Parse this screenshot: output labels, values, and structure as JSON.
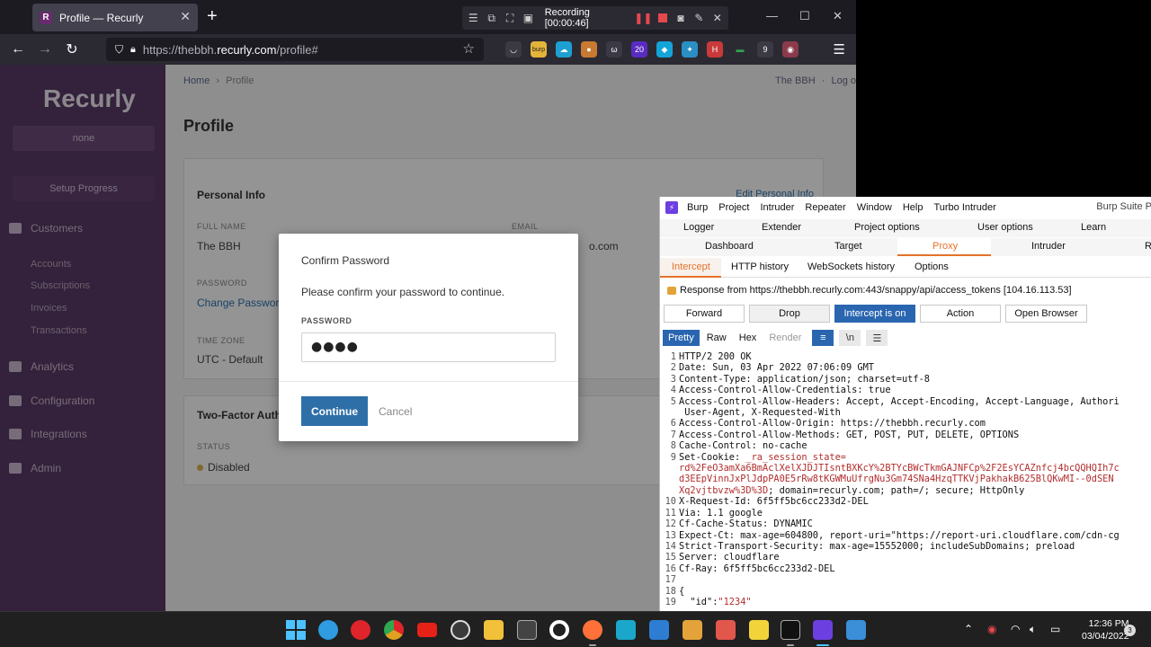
{
  "browser": {
    "tab_title": "Profile — Recurly",
    "tab_favicon": "R",
    "recording": "Recording [00:00:46]",
    "url_prefix": "https://thebbh.",
    "url_domain": "recurly.com",
    "url_suffix": "/profile#",
    "ext_burp": "burp",
    "ext_badge_20": "20",
    "ext_badge_9": "9"
  },
  "page": {
    "logo": "Recurly",
    "account_pill": "none",
    "setup_progress": "Setup Progress",
    "nav": {
      "customers": "Customers",
      "accounts": "Accounts",
      "subscriptions": "Subscriptions",
      "invoices": "Invoices",
      "transactions": "Transactions",
      "analytics": "Analytics",
      "configuration": "Configuration",
      "integrations": "Integrations",
      "admin": "Admin"
    },
    "breadcrumb_home": "Home",
    "breadcrumb_sep": "›",
    "breadcrumb_current": "Profile",
    "top_user": "The BBH",
    "top_sep": "·",
    "top_logout": "Log o",
    "title": "Profile",
    "personal_info": "Personal Info",
    "edit_personal_info": "Edit Personal Info",
    "full_name_label": "FULL NAME",
    "full_name": "The BBH",
    "email_label": "EMAIL",
    "email_tail": "o.com",
    "password_label": "PASSWORD",
    "change_password": "Change Password",
    "time_zone_label": "TIME ZONE",
    "time_zone": "UTC - Default",
    "two_factor": "Two-Factor Authe",
    "status_label": "STATUS",
    "status": "Disabled"
  },
  "modal": {
    "title": "Confirm Password",
    "description": "Please confirm your password to continue.",
    "password_label": "PASSWORD",
    "password_value": "●●●●",
    "continue": "Continue",
    "cancel": "Cancel"
  },
  "burp": {
    "menus": [
      "Burp",
      "Project",
      "Intruder",
      "Repeater",
      "Window",
      "Help",
      "Turbo Intruder"
    ],
    "window_title": "Burp Suite P",
    "tabs_row1": [
      "Logger",
      "Extender",
      "Project options",
      "User options",
      "Learn"
    ],
    "tabs_row2": [
      "Dashboard",
      "Target",
      "Proxy",
      "Intruder",
      "R"
    ],
    "subtabs": [
      "Intercept",
      "HTTP history",
      "WebSockets history",
      "Options"
    ],
    "response_info": "Response from https://thebbh.recurly.com:443/snappy/api/access_tokens  [104.16.113.53]",
    "buttons": {
      "forward": "Forward",
      "drop": "Drop",
      "intercept": "Intercept is on",
      "action": "Action",
      "open_browser": "Open Browser"
    },
    "view": {
      "pretty": "Pretty",
      "raw": "Raw",
      "hex": "Hex",
      "render": "Render",
      "wrap_icon": "wrap-icon",
      "newline": "\\n",
      "menu_icon": "menu-icon"
    },
    "lines": [
      {
        "n": "1",
        "t": "HTTP/2 200 OK"
      },
      {
        "n": "2",
        "t": "Date: Sun, 03 Apr 2022 07:06:09 GMT"
      },
      {
        "n": "3",
        "t": "Content-Type: application/json; charset=utf-8"
      },
      {
        "n": "4",
        "t": "Access-Control-Allow-Credentials: true"
      },
      {
        "n": "5",
        "t": "Access-Control-Allow-Headers: Accept, Accept-Encoding, Accept-Language, Authori"
      },
      {
        "n": "",
        "t": " User-Agent, X-Requested-With"
      },
      {
        "n": "6",
        "t": "Access-Control-Allow-Origin: https://thebbh.recurly.com"
      },
      {
        "n": "7",
        "t": "Access-Control-Allow-Methods: GET, POST, PUT, DELETE, OPTIONS"
      },
      {
        "n": "8",
        "t": "Cache-Control: no-cache"
      },
      {
        "n": "9",
        "t": "Set-Cookie: _ra_session_state="
      },
      {
        "n": "",
        "t": "rd%2FeO3amXa6BmAclXelXJDJTIsntBXKcY%2BTYcBWcTkmGAJNFCp%2F2EsYCAZnfcj4bcQQHQIh7c",
        "c": true
      },
      {
        "n": "",
        "t": "d3EEpVinnJxPlJdpPA0E5rRw8tKGWMuUfrgNu3Gm74SNa4HzqTTKVjPakhakB625BlQKwMI--0dSEN",
        "c": true
      },
      {
        "n": "",
        "t": "Xq2vjtbvzw%3D%3D; domain=recurly.com; path=/; secure; HttpOnly"
      },
      {
        "n": "10",
        "t": "X-Request-Id: 6f5ff5bc6cc233d2-DEL"
      },
      {
        "n": "11",
        "t": "Via: 1.1 google"
      },
      {
        "n": "12",
        "t": "Cf-Cache-Status: DYNAMIC"
      },
      {
        "n": "13",
        "t": "Expect-Ct: max-age=604800, report-uri=\"https://report-uri.cloudflare.com/cdn-cg"
      },
      {
        "n": "14",
        "t": "Strict-Transport-Security: max-age=15552000; includeSubDomains; preload"
      },
      {
        "n": "15",
        "t": "Server: cloudflare"
      },
      {
        "n": "16",
        "t": "Cf-Ray: 6f5ff5bc6cc233d2-DEL"
      },
      {
        "n": "17",
        "t": ""
      },
      {
        "n": "18",
        "t": "{"
      },
      {
        "n": "19",
        "t": "  \"id\":\"1234\""
      }
    ]
  },
  "taskbar": {
    "time": "12:36 PM",
    "date": "03/04/2022",
    "notifications": "3",
    "colors": {
      "edge": "#2f9be0",
      "opera": "#e0242b",
      "chrome": "#e0a020",
      "youtube": "#e62117",
      "folder": "#f2c13a",
      "firefox": "#ff7139",
      "burp": "#6b3fe0"
    }
  }
}
